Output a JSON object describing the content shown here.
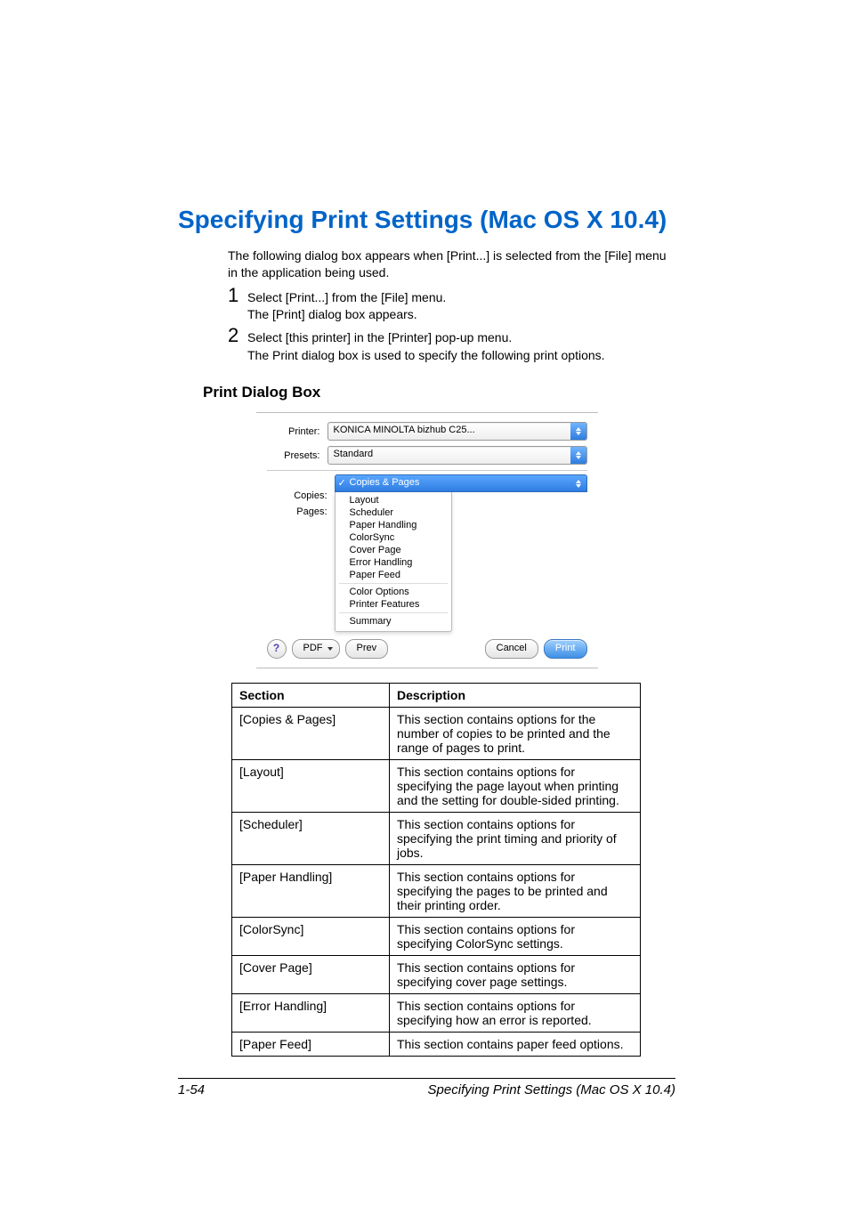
{
  "title": "Specifying Print Settings (Mac OS X 10.4)",
  "intro": "The following dialog box appears when [Print...] is selected from the [File] menu in the application being used.",
  "steps": [
    {
      "primary": "Select [Print...] from the [File] menu.",
      "secondary": "The [Print] dialog box appears."
    },
    {
      "primary": "Select [this printer] in the [Printer] pop-up menu.",
      "secondary": "The Print dialog box is used to specify the following print options."
    }
  ],
  "subhead": "Print Dialog Box",
  "dialog": {
    "labels": {
      "printer": "Printer:",
      "presets": "Presets:",
      "copies": "Copies:",
      "pages": "Pages:"
    },
    "printer_value": "KONICA MINOLTA bizhub C25...",
    "presets_value": "Standard",
    "panel_selected": "Copies & Pages",
    "panel_items": [
      "Layout",
      "Scheduler",
      "Paper Handling",
      "ColorSync",
      "Cover Page",
      "Error Handling",
      "Paper Feed",
      "Color Options",
      "Printer Features",
      "Summary"
    ],
    "buttons": {
      "help": "?",
      "pdf": "PDF",
      "preview": "Prev",
      "cancel": "Cancel",
      "print": "Print"
    }
  },
  "table": {
    "headers": {
      "section": "Section",
      "description": "Description"
    },
    "rows": [
      {
        "section": "[Copies & Pages]",
        "desc": "This section contains options for the number of copies to be printed and the range of pages to print."
      },
      {
        "section": "[Layout]",
        "desc": "This section contains options for specifying the page layout when printing and the setting for double-sided printing."
      },
      {
        "section": "[Scheduler]",
        "desc": "This section contains options for specifying the print timing and priority of jobs."
      },
      {
        "section": "[Paper Handling]",
        "desc": "This section contains options for specifying the pages to be printed and their printing order."
      },
      {
        "section": "[ColorSync]",
        "desc": "This section contains options for specifying ColorSync settings."
      },
      {
        "section": "[Cover Page]",
        "desc": "This section contains options for specifying cover page settings."
      },
      {
        "section": "[Error Handling]",
        "desc": "This section contains options for specifying how an error is reported."
      },
      {
        "section": "[Paper Feed]",
        "desc": "This section contains paper feed options."
      }
    ]
  },
  "footer": {
    "page": "1-54",
    "title": "Specifying Print Settings (Mac OS X 10.4)"
  }
}
